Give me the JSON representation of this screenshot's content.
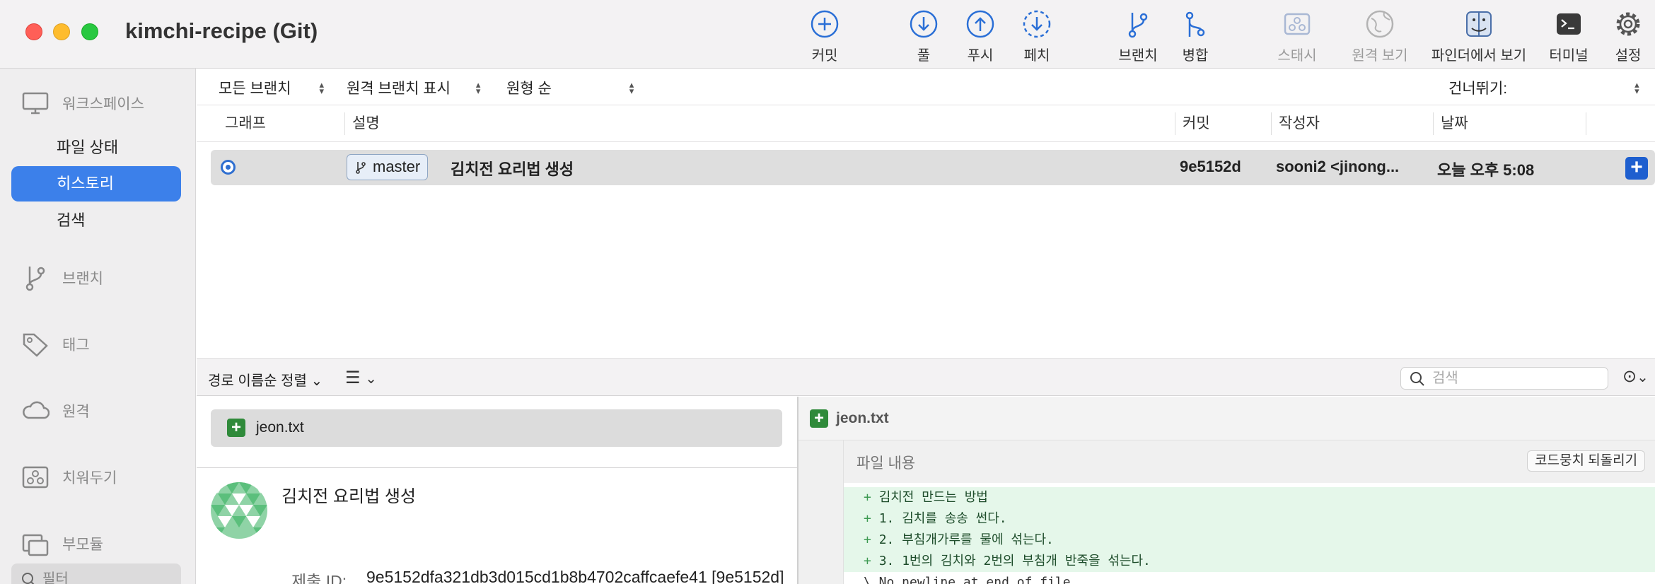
{
  "window": {
    "title": "kimchi-recipe (Git)"
  },
  "toolbar": {
    "commit": "커밋",
    "pull": "풀",
    "push": "푸시",
    "fetch": "페치",
    "branch": "브랜치",
    "merge": "병합",
    "stash": "스태시",
    "remote_view": "원격 보기",
    "finder": "파인더에서 보기",
    "terminal": "터미널",
    "settings": "설정"
  },
  "sidebar": {
    "workspace": "워크스페이스",
    "items": [
      {
        "label": "파일 상태"
      },
      {
        "label": "히스토리",
        "active": true
      },
      {
        "label": "검색"
      }
    ],
    "branches": "브랜치",
    "tags": "태그",
    "remotes": "원격",
    "stashes": "치워두기",
    "submodules": "부모듈",
    "filter_placeholder": "필터"
  },
  "filters": {
    "all_branches": "모든 브랜치",
    "show_remote": "원격 브랜치 표시",
    "order": "원형 순",
    "jump": "건너뛰기:"
  },
  "columns": {
    "graph": "그래프",
    "description": "설명",
    "commit": "커밋",
    "author": "작성자",
    "date": "날짜"
  },
  "commits": [
    {
      "branch": "master",
      "message": "김치전 요리법 생성",
      "hash": "9e5152d",
      "author": "sooni2 <jinong...",
      "date": "오늘 오후 5:08"
    }
  ],
  "lower_bar": {
    "sort": "경로 이름순 정렬",
    "search_placeholder": "검색"
  },
  "files": [
    {
      "name": "jeon.txt",
      "status": "added"
    }
  ],
  "detail": {
    "title": "김치전 요리법 생성",
    "id_label": "제출 ID:",
    "id_value": "9e5152dfa321db3d015cd1b8b4702caffcaefe41 [9e5152d]"
  },
  "diff": {
    "file": "jeon.txt",
    "hunk_label": "파일 내용",
    "revert": "코드뭉치 되돌리기",
    "lines": [
      {
        "type": "add",
        "text": "김치전 만드는 방법"
      },
      {
        "type": "add",
        "text": "1. 김치를 송송 썬다."
      },
      {
        "type": "add",
        "text": "2. 부침개가루를 물에 섞는다."
      },
      {
        "type": "add",
        "text": "3. 1번의 김치와 2번의 부침개 반죽을 섞는다."
      },
      {
        "type": "note",
        "text": "\\ No newline at end of file"
      }
    ]
  },
  "colors": {
    "accent": "#3c80ea",
    "added": "#2f8a3a",
    "diff_add_bg": "#e5f7ea"
  }
}
